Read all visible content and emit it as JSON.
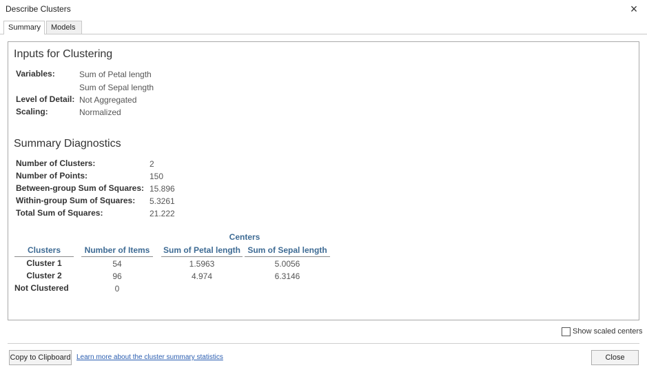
{
  "window": {
    "title": "Describe Clusters",
    "close_glyph": "×"
  },
  "tabs": [
    {
      "label": "Summary"
    },
    {
      "label": "Models"
    }
  ],
  "inputs": {
    "heading": "Inputs for Clustering",
    "variables_label": "Variables:",
    "variables": [
      "Sum of Petal length",
      "Sum of Sepal length"
    ],
    "level_label": "Level of Detail:",
    "level_value": "Not Aggregated",
    "scaling_label": "Scaling:",
    "scaling_value": "Normalized"
  },
  "diagnostics": {
    "heading": "Summary Diagnostics",
    "rows": [
      {
        "label": "Number of Clusters:",
        "value": "2"
      },
      {
        "label": "Number of Points:",
        "value": "150"
      },
      {
        "label": "Between-group Sum of Squares:",
        "value": "15.896"
      },
      {
        "label": "Within-group Sum of Squares:",
        "value": "5.3261"
      },
      {
        "label": "Total Sum of Squares:",
        "value": "21.222"
      }
    ]
  },
  "table": {
    "group_header": "Centers",
    "columns": [
      "Clusters",
      "Number of Items",
      "Sum of Petal length",
      "Sum of Sepal length"
    ],
    "rows": [
      {
        "cluster": "Cluster 1",
        "items": "54",
        "petal": "1.5963",
        "sepal": "5.0056"
      },
      {
        "cluster": "Cluster 2",
        "items": "96",
        "petal": "4.974",
        "sepal": "6.3146"
      },
      {
        "cluster": "Not Clustered",
        "items": "0",
        "petal": "",
        "sepal": ""
      }
    ]
  },
  "options": {
    "show_scaled_centers_label": "Show scaled centers",
    "show_scaled_centers_checked": false
  },
  "footer": {
    "copy_button": "Copy to Clipboard",
    "learn_more_link": "Learn more about the cluster summary statistics",
    "close_button": "Close"
  },
  "icons": {
    "close": "close-icon",
    "checkbox": "checkbox-icon"
  },
  "colors": {
    "header_blue": "#3e6b94",
    "link_blue": "#2a5db0"
  }
}
